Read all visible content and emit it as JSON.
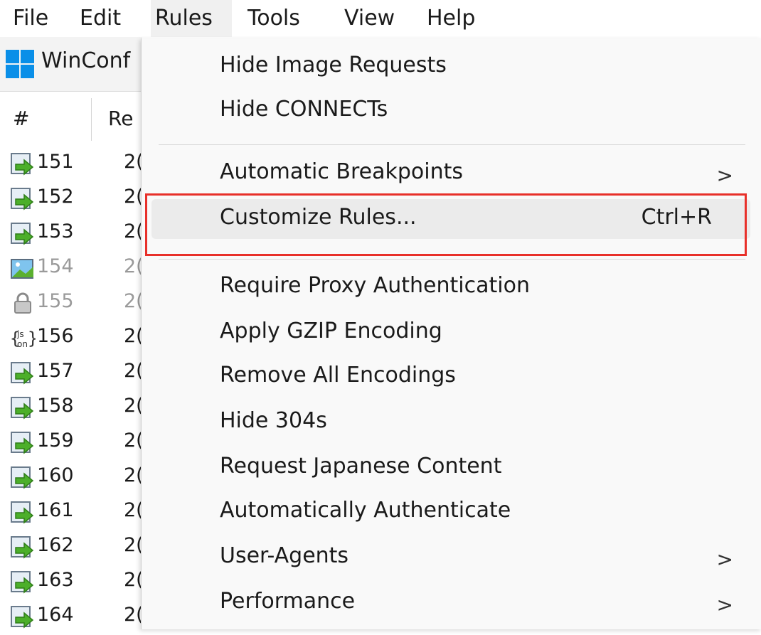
{
  "menubar": {
    "items": [
      {
        "label": "File"
      },
      {
        "label": "Edit"
      },
      {
        "label": "Rules"
      },
      {
        "label": "Tools"
      },
      {
        "label": "View"
      },
      {
        "label": "Help"
      }
    ]
  },
  "toolbar": {
    "label": "WinConf",
    "icon": "windows-logo-icon"
  },
  "sessions": {
    "columns": {
      "hash": "#",
      "result": "Re"
    },
    "rows": [
      {
        "num": "151",
        "result": "2(",
        "icon": "arrow-icon"
      },
      {
        "num": "152",
        "result": "2(",
        "icon": "arrow-icon"
      },
      {
        "num": "153",
        "result": "2(",
        "icon": "arrow-icon"
      },
      {
        "num": "154",
        "result": "2(",
        "icon": "image-icon"
      },
      {
        "num": "155",
        "result": "2(",
        "icon": "lock-icon"
      },
      {
        "num": "156",
        "result": "2(",
        "icon": "json-icon"
      },
      {
        "num": "157",
        "result": "2(",
        "icon": "arrow-icon"
      },
      {
        "num": "158",
        "result": "2(",
        "icon": "arrow-icon"
      },
      {
        "num": "159",
        "result": "2(",
        "icon": "arrow-icon"
      },
      {
        "num": "160",
        "result": "2(",
        "icon": "arrow-icon"
      },
      {
        "num": "161",
        "result": "2(",
        "icon": "arrow-icon"
      },
      {
        "num": "162",
        "result": "2(",
        "icon": "arrow-icon"
      },
      {
        "num": "163",
        "result": "2(",
        "icon": "arrow-icon"
      },
      {
        "num": "164",
        "result": "2(",
        "icon": "arrow-icon"
      }
    ]
  },
  "rules_menu": {
    "items": [
      {
        "label": "Hide Image Requests"
      },
      {
        "label": "Hide CONNECTs"
      },
      {
        "label": "Automatic Breakpoints",
        "submenu": true
      },
      {
        "label": "Customize Rules...",
        "shortcut": "Ctrl+R",
        "highlighted": true
      },
      {
        "label": "Require Proxy Authentication"
      },
      {
        "label": "Apply GZIP Encoding"
      },
      {
        "label": "Remove All Encodings"
      },
      {
        "label": "Hide 304s"
      },
      {
        "label": "Request Japanese Content"
      },
      {
        "label": "Automatically Authenticate"
      },
      {
        "label": "User-Agents",
        "submenu": true
      },
      {
        "label": "Performance",
        "submenu": true
      }
    ],
    "submenu_arrow": ">"
  },
  "colors": {
    "highlight_border": "#e8302a",
    "accent": "#0a8fe8"
  }
}
